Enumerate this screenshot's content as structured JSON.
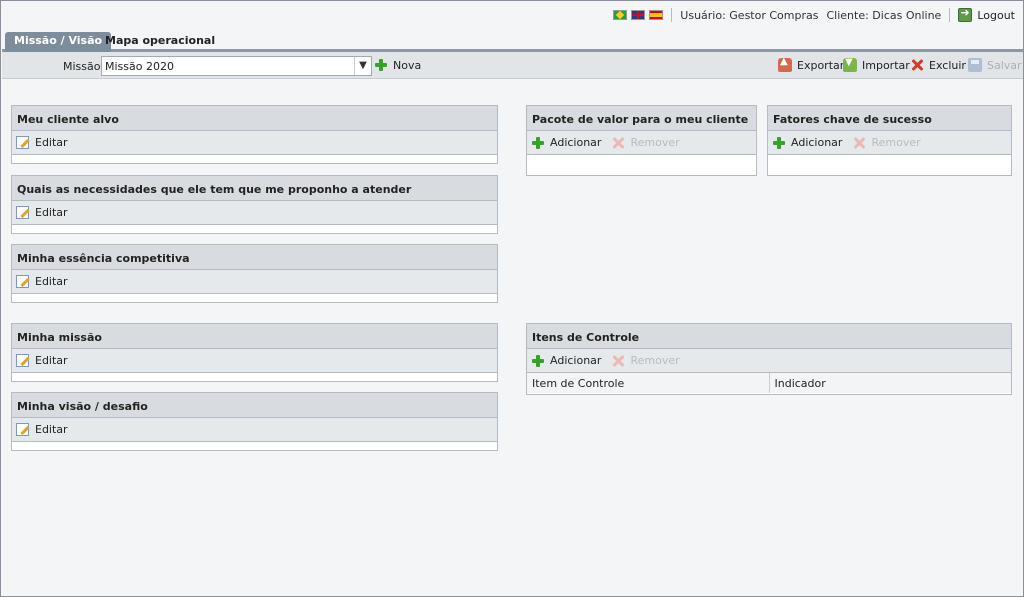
{
  "header": {
    "flags": [
      "brazil-flag-icon",
      "uk-flag-icon",
      "spain-flag-icon"
    ],
    "user": "Usuário: Gestor Compras",
    "client": "Cliente: Dicas Online",
    "logout": "Logout"
  },
  "tabs": [
    {
      "label": "Missão / Visão",
      "active": true
    },
    {
      "label": "Mapa operacional",
      "active": false
    }
  ],
  "toolbar": {
    "mission_label": "Missão:",
    "mission_value": "Missão 2020",
    "new_label": "Nova",
    "export_label": "Exportar",
    "import_label": "Importar",
    "delete_label": "Excluir",
    "save_label": "Salvar"
  },
  "panels": {
    "target_client": {
      "title": "Meu cliente alvo",
      "edit": "Editar"
    },
    "needs": {
      "title": "Quais as necessidades que ele tem que me proponho a atender",
      "edit": "Editar"
    },
    "essence": {
      "title": "Minha essência competitiva",
      "edit": "Editar"
    },
    "mission": {
      "title": "Minha missão",
      "edit": "Editar"
    },
    "vision": {
      "title": "Minha visão / desafio",
      "edit": "Editar"
    },
    "value_package": {
      "title": "Pacote de valor para o meu cliente",
      "add": "Adicionar",
      "remove": "Remover"
    },
    "success_factors": {
      "title": "Fatores chave de sucesso",
      "add": "Adicionar",
      "remove": "Remover"
    },
    "control_items": {
      "title": "Itens de Controle",
      "add": "Adicionar",
      "remove": "Remover",
      "columns": [
        "Item de Controle",
        "Indicador"
      ]
    }
  },
  "colors": {
    "accent_tab": "#7e8d9c",
    "add_green": "#36a22a",
    "delete_red": "#d63a2a"
  }
}
